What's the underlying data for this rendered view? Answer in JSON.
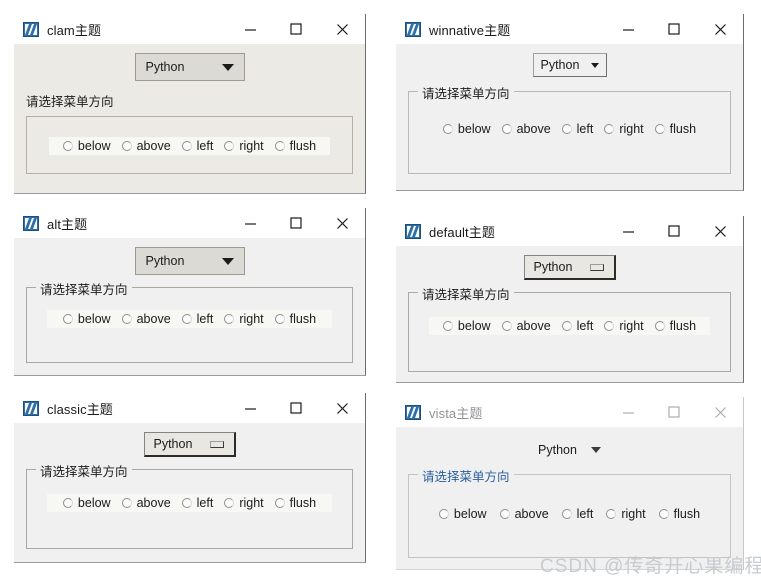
{
  "watermark": "CSDN @传奇开心果编程",
  "caption_buttons": {
    "minimize": "minimize",
    "maximize": "maximize",
    "close": "close"
  },
  "shared": {
    "combo_value": "Python",
    "group_label": "请选择菜单方向",
    "radio_options": [
      "below",
      "above",
      "left",
      "right",
      "flush"
    ]
  },
  "windows": [
    {
      "id": "clam",
      "title": "clam主题",
      "active": true,
      "combo_style": "clam",
      "group_style": "caption-above",
      "label_color": "#1b1b1b"
    },
    {
      "id": "winnative",
      "title": "winnative主题",
      "active": true,
      "combo_style": "native",
      "group_style": "legend",
      "label_color": "#1b1b1b"
    },
    {
      "id": "alt",
      "title": "alt主题",
      "active": true,
      "combo_style": "clam",
      "group_style": "legend",
      "label_color": "#1b1b1b"
    },
    {
      "id": "default",
      "title": "default主题",
      "active": true,
      "combo_style": "classic",
      "group_style": "legend",
      "label_color": "#1b1b1b"
    },
    {
      "id": "classic",
      "title": "classic主题",
      "active": true,
      "combo_style": "classic",
      "group_style": "legend",
      "label_color": "#1b1b1b"
    },
    {
      "id": "vista",
      "title": "vista主题",
      "active": false,
      "combo_style": "vista",
      "group_style": "legend",
      "label_color": "#2b5f9e"
    }
  ]
}
